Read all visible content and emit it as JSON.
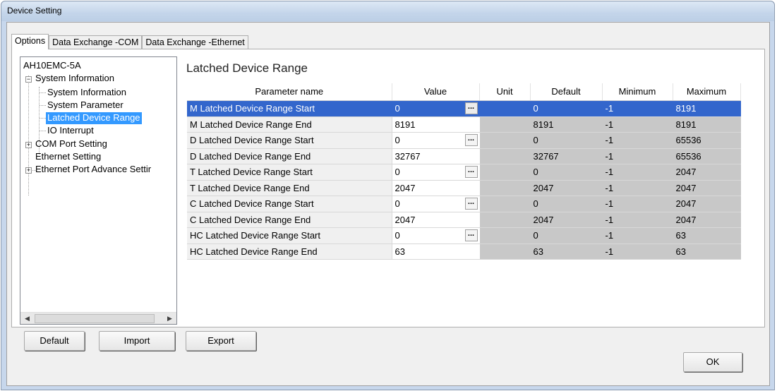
{
  "window": {
    "title": "Device Setting"
  },
  "tabs": [
    {
      "label": "Options",
      "active": true
    },
    {
      "label": "Data Exchange -COM",
      "active": false
    },
    {
      "label": "Data Exchange -Ethernet",
      "active": false
    }
  ],
  "tree": {
    "root": "AH10EMC-5A",
    "system_information": "System Information",
    "system_information_child": "System Information",
    "system_parameter": "System Parameter",
    "latched_device_range": "Latched Device Range",
    "io_interrupt": "IO Interrupt",
    "com_port_setting": "COM Port Setting",
    "ethernet_setting": "Ethernet Setting",
    "ethernet_port_advance": "Ethernet Port Advance Settir",
    "selected": "Latched Device Range"
  },
  "section_title": "Latched Device Range",
  "grid": {
    "columns": [
      "Parameter name",
      "Value",
      "Unit",
      "Default",
      "Minimum",
      "Maximum"
    ],
    "rows": [
      {
        "name": "M Latched Device Range Start",
        "value": "0",
        "unit": "",
        "default": "0",
        "minimum": "-1",
        "maximum": "8191"
      },
      {
        "name": "M Latched Device Range End",
        "value": "8191",
        "unit": "",
        "default": "8191",
        "minimum": "-1",
        "maximum": "8191"
      },
      {
        "name": "D Latched Device Range Start",
        "value": "0",
        "unit": "",
        "default": "0",
        "minimum": "-1",
        "maximum": "65536"
      },
      {
        "name": "D Latched Device Range End",
        "value": "32767",
        "unit": "",
        "default": "32767",
        "minimum": "-1",
        "maximum": "65536"
      },
      {
        "name": "T Latched Device Range Start",
        "value": "0",
        "unit": "",
        "default": "0",
        "minimum": "-1",
        "maximum": "2047"
      },
      {
        "name": "T Latched Device Range End",
        "value": "2047",
        "unit": "",
        "default": "2047",
        "minimum": "-1",
        "maximum": "2047"
      },
      {
        "name": "C Latched Device Range Start",
        "value": "0",
        "unit": "",
        "default": "0",
        "minimum": "-1",
        "maximum": "2047"
      },
      {
        "name": "C Latched Device Range End",
        "value": "2047",
        "unit": "",
        "default": "2047",
        "minimum": "-1",
        "maximum": "2047"
      },
      {
        "name": "HC Latched Device Range Start",
        "value": "0",
        "unit": "",
        "default": "0",
        "minimum": "-1",
        "maximum": "63"
      },
      {
        "name": "HC Latched Device Range End",
        "value": "63",
        "unit": "",
        "default": "63",
        "minimum": "-1",
        "maximum": "63"
      }
    ],
    "ellipsis": "..."
  },
  "buttons": {
    "default": "Default",
    "import": "Import",
    "export": "Export",
    "ok": "OK"
  },
  "tree_toggles": {
    "collapse": "−",
    "expand": "+"
  },
  "scroll_arrows": {
    "left": "◀",
    "right": "▶"
  },
  "colors": {
    "selection_tree": "#3399ff",
    "selection_row": "#3366cc",
    "readonly_cell": "#c8c8c8"
  }
}
